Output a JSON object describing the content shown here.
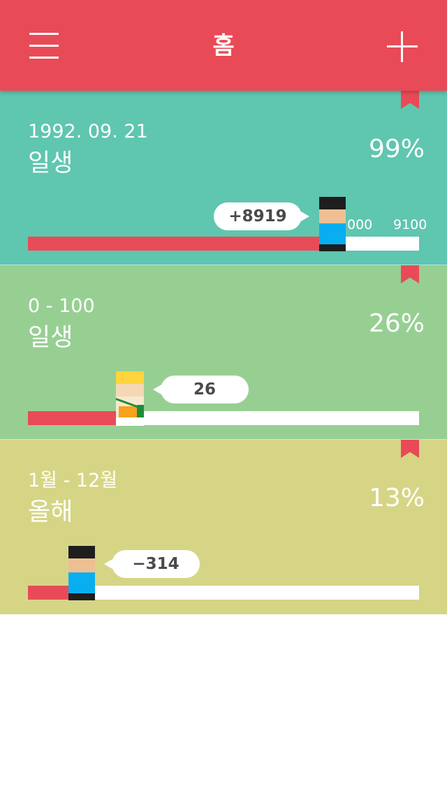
{
  "header": {
    "title": "홈",
    "background": "#e84b57",
    "left_icon": "menu-icon",
    "right_icon": "add-icon"
  },
  "cards": [
    {
      "range": "1992. 09. 21",
      "name": "일생",
      "percent": "99%",
      "progress": 0.8,
      "bubble": "+8919",
      "character": "boy",
      "tick_labels": [
        "000",
        "9100"
      ],
      "background": "#5fc6b0"
    },
    {
      "range": "0 - 100",
      "name": "일생",
      "percent": "26%",
      "progress": 0.26,
      "bubble": "26",
      "character": "girl",
      "background": "#97cf93"
    },
    {
      "range": "1월 - 12월",
      "name": "올해",
      "percent": "13%",
      "progress": 0.13,
      "bubble": "−314",
      "character": "boy",
      "background": "#d6d586"
    }
  ],
  "colors": {
    "accent": "#e84b57",
    "bookmark": "#e84b57"
  }
}
